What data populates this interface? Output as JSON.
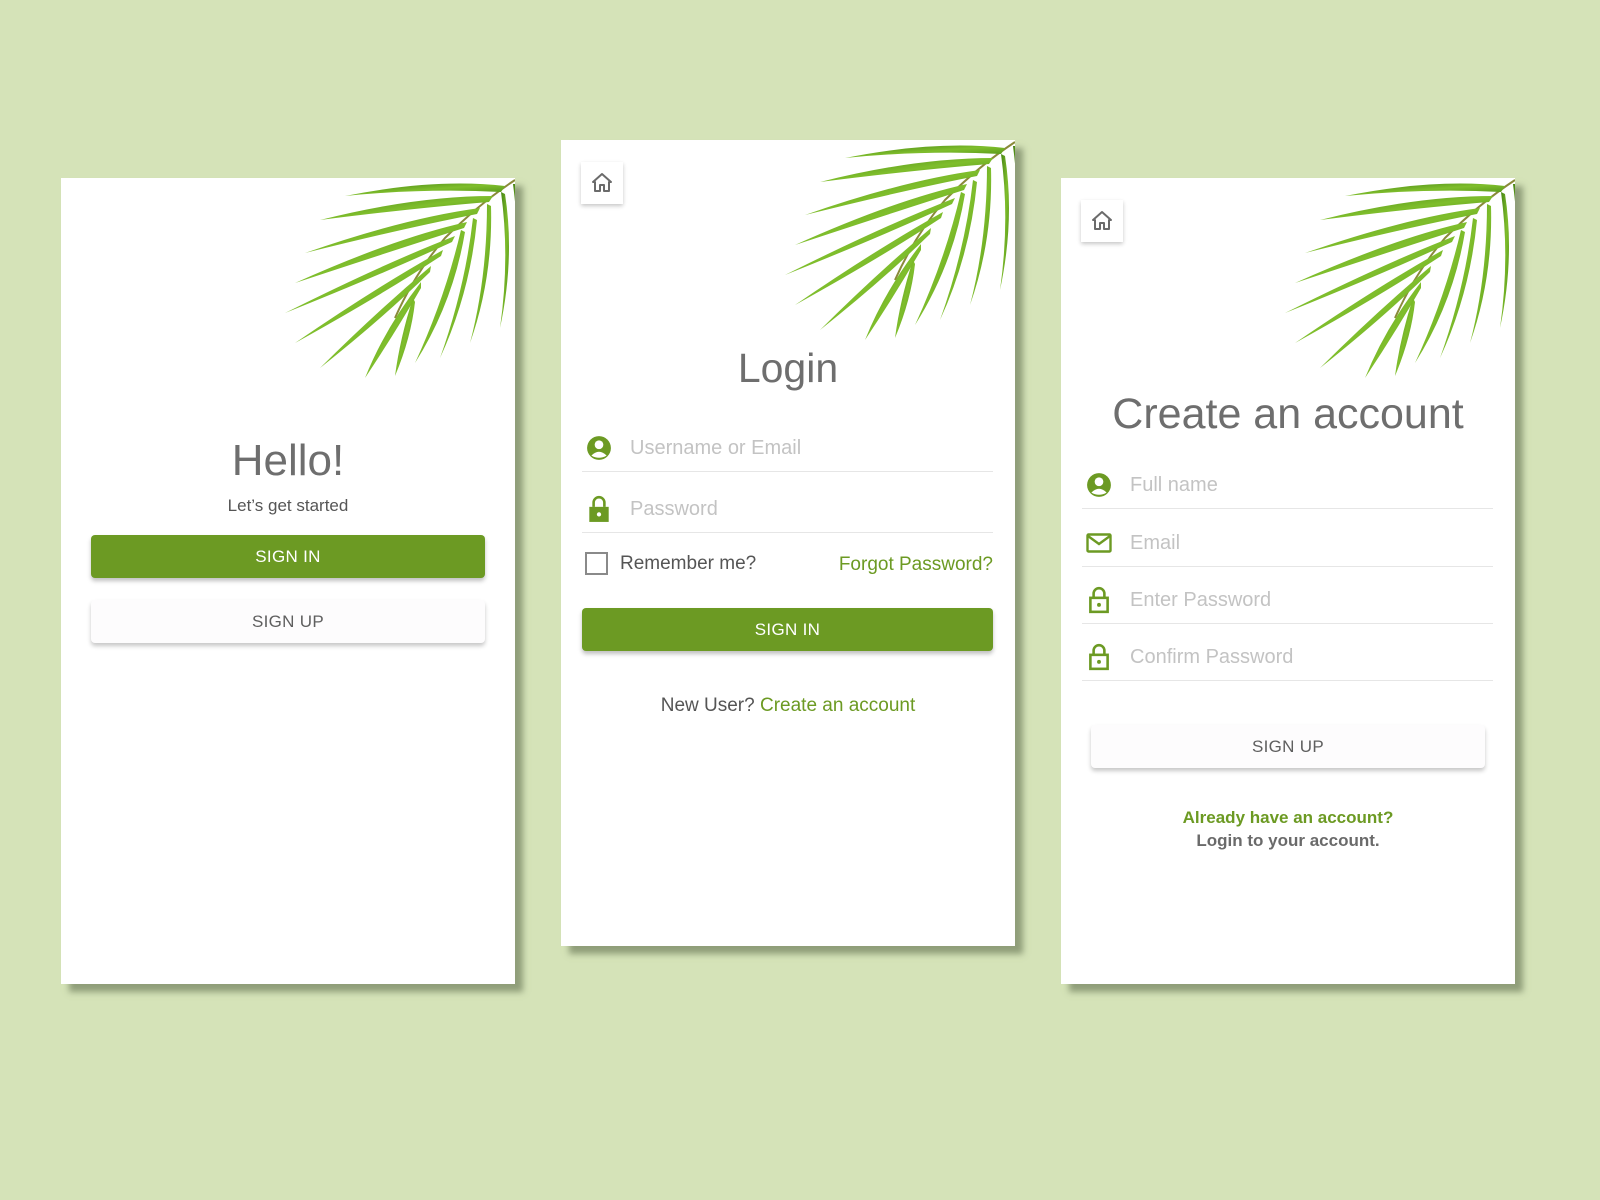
{
  "colors": {
    "background": "#d5e3b8",
    "accent": "#6c9a23",
    "text": "#6e6e6e",
    "placeholder": "#c3c3c3"
  },
  "welcome_screen": {
    "title": "Hello!",
    "subtitle": "Let’s get started",
    "sign_in_label": "SIGN IN",
    "sign_up_label": "SIGN UP",
    "decoration": "palm-leaf"
  },
  "login_screen": {
    "home_icon": "home-icon",
    "title": "Login",
    "username_placeholder": "Username or Email",
    "username_icon": "account-circle-icon",
    "password_placeholder": "Password",
    "password_icon": "lock-icon",
    "remember_label": "Remember me?",
    "remember_checked": false,
    "forgot_label": "Forgot Password?",
    "sign_in_label": "SIGN IN",
    "new_user_label": "New User?",
    "create_account_link": "Create an account"
  },
  "signup_screen": {
    "home_icon": "home-icon",
    "title": "Create an account",
    "fields": [
      {
        "placeholder": "Full name",
        "icon": "account-circle-icon"
      },
      {
        "placeholder": "Email",
        "icon": "mail-icon"
      },
      {
        "placeholder": "Enter Password",
        "icon": "lock-outline-icon"
      },
      {
        "placeholder": "Confirm Password",
        "icon": "lock-outline-icon"
      }
    ],
    "sign_up_label": "SIGN UP",
    "already_label": "Already have an account?",
    "login_link": "Login to your account."
  }
}
